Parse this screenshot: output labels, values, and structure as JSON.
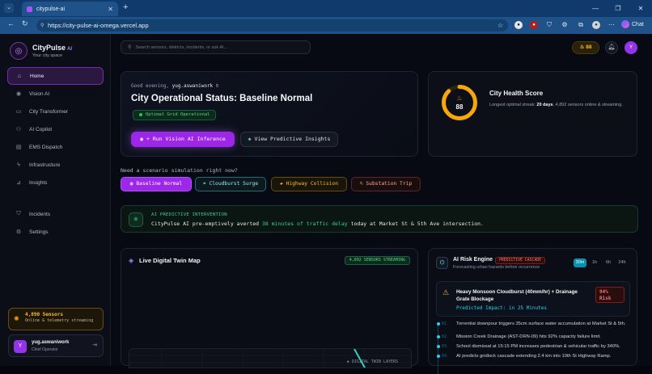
{
  "browser": {
    "tab_title": "citypulse-ai",
    "url": "https://city-pulse-ai-omega.vercel.app",
    "chat_label": "Chat"
  },
  "brand": {
    "name": "CityPulse",
    "suffix": "AI",
    "tagline": "Your city space"
  },
  "nav": [
    {
      "label": "Home",
      "icon": "home-icon",
      "active": true
    },
    {
      "label": "Vision AI",
      "icon": "eye-icon"
    },
    {
      "label": "City Transformer",
      "icon": "transform-icon"
    },
    {
      "label": "AI Copilot",
      "icon": "copilot-icon"
    },
    {
      "label": "EMS Dispatch",
      "icon": "ambulance-icon"
    },
    {
      "label": "Infrastructure",
      "icon": "bolt-icon"
    },
    {
      "label": "Insights",
      "icon": "chart-icon"
    },
    {
      "label": "Incidents",
      "icon": "shield-icon"
    },
    {
      "label": "Settings",
      "icon": "gear-icon"
    }
  ],
  "sensors": {
    "count_label": "4,890 Sensors",
    "status": "Online & telemetry streaming"
  },
  "user": {
    "initial": "Y",
    "name": "yug.aswaniwork",
    "role": "Chief Operator"
  },
  "search": {
    "placeholder": "Search sensors, districts, incidents, or ask AI..."
  },
  "topbar": {
    "streak": "88",
    "avatar": "Y"
  },
  "hero": {
    "greeting": "Good evening,",
    "username": "yug.aswaniwork",
    "title": "City Operational Status: Baseline Normal",
    "badge": "Optimal Grid Operational",
    "run_button": "+ Run Vision AI Inference",
    "insights_button": "View Predictive Insights"
  },
  "health": {
    "score": 88,
    "title": "City Health Score",
    "text_a": "Longest optimal streak:",
    "streak": "20 days",
    "text_b": ", 4,892 sensors online & streaming."
  },
  "scenario": {
    "prompt": "Need a scenario simulation right now?",
    "options": [
      "Baseline Normal",
      "Cloudburst Surge",
      "Highway Collision",
      "Substation Trip"
    ]
  },
  "intervention": {
    "label": "AI PREDICTIVE INTERVENTION",
    "text_a": "CityPulse AI pre-emptively averted",
    "highlight": "38 minutes of traffic delay",
    "text_b": "today at Market St & 5th Ave intersection."
  },
  "twin": {
    "title": "Live Digital Twin Map",
    "badge": "4,892 SENSORS STREAMING",
    "layers": "DIGITAL TWIN LAYERS"
  },
  "risk": {
    "title": "AI Risk Engine",
    "badge": "PREDICTIVE CASCADE",
    "subtitle": "Forecasting urban hazards before occurrence",
    "windows": [
      "30m",
      "1h",
      "6h",
      "24h"
    ],
    "active_window": "30m",
    "event_title": "Heavy Monsoon Cloudburst (40mm/hr) + Drainage Grate Blockage",
    "event_impact": "Predicted Impact: in 25 Minutes",
    "risk_pct": "94%",
    "risk_label": "Risk",
    "steps": [
      {
        "n": "01.",
        "text": "Torrential downpour triggers 35cm surface water accumulation at Market St & 5th."
      },
      {
        "n": "02.",
        "text": "Mission Creek Drainage (AST-DRN-09) hits 92% capacity failure limit."
      },
      {
        "n": "03.",
        "text": "School dismissal at 15:15 PM increases pedestrian & vehicular traffic by 340%."
      },
      {
        "n": "04.",
        "text": "AI predicts gridlock cascade extending 2.4 km into 10th St Highway Ramp."
      }
    ]
  },
  "colors": {
    "accent": "#9d27e8",
    "success": "#34d399",
    "warning": "#fbbf24",
    "danger": "#f87171",
    "info": "#22d3ee"
  }
}
